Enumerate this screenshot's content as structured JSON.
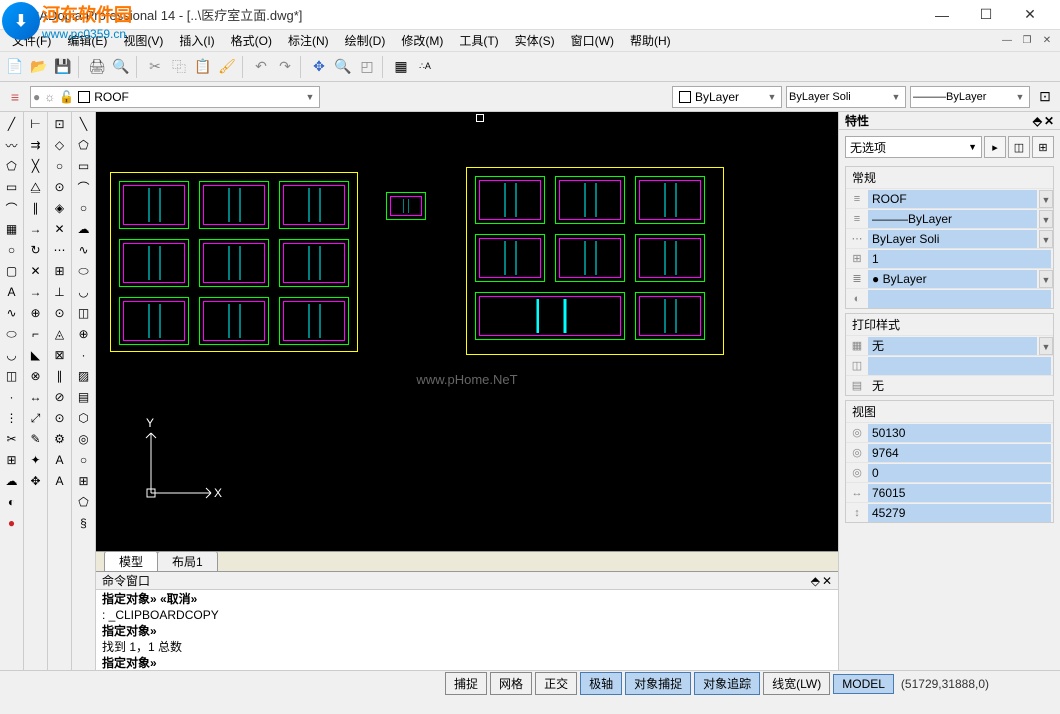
{
  "title": "CADopia Professional 14 - [..\\医疗室立面.dwg*]",
  "watermark": {
    "text": "河东软件园",
    "url": "www.pc0359.cn"
  },
  "menus": [
    "文件(F)",
    "编辑(E)",
    "视图(V)",
    "插入(I)",
    "格式(O)",
    "标注(N)",
    "绘制(D)",
    "修改(M)",
    "工具(T)",
    "实体(S)",
    "窗口(W)",
    "帮助(H)"
  ],
  "layer": {
    "name": "ROOF"
  },
  "layerControls": {
    "color": "ByLayer",
    "linetype": "ByLayer      Soli",
    "lineweight": "———ByLayer"
  },
  "props": {
    "panelTitle": "特性",
    "selection": "无选项",
    "groups": {
      "general": {
        "title": "常规",
        "rows": [
          "ROOF",
          "———ByLayer",
          "ByLayer      Soli",
          "1",
          "● ByLayer",
          ""
        ]
      },
      "print": {
        "title": "打印样式",
        "rows": [
          "无",
          "",
          "无"
        ]
      },
      "view": {
        "title": "视图",
        "rows": [
          "50130",
          "9764",
          "0",
          "76015",
          "45279"
        ]
      }
    }
  },
  "tabs": [
    "模型",
    "布局1"
  ],
  "cmdTitle": "命令窗口",
  "cmd": [
    {
      "t": "指定对象» «取消»",
      "b": true
    },
    {
      "t": ": _CLIPBOARDCOPY",
      "b": false
    },
    {
      "t": "指定对象»",
      "b": true
    },
    {
      "t": "找到 1，1 总数",
      "b": false
    },
    {
      "t": "指定对象»",
      "b": true
    }
  ],
  "canvasWatermark": "www.pHome.NeT",
  "status": {
    "buttons": [
      {
        "label": "捕捉",
        "active": false
      },
      {
        "label": "网格",
        "active": false
      },
      {
        "label": "正交",
        "active": false
      },
      {
        "label": "极轴",
        "active": true
      },
      {
        "label": "对象捕捉",
        "active": true
      },
      {
        "label": "对象追踪",
        "active": true
      },
      {
        "label": "线宽(LW)",
        "active": false
      },
      {
        "label": "MODEL",
        "active": true
      }
    ],
    "coords": "(51729,31888,0)"
  },
  "ucs": {
    "x": "X",
    "y": "Y"
  }
}
